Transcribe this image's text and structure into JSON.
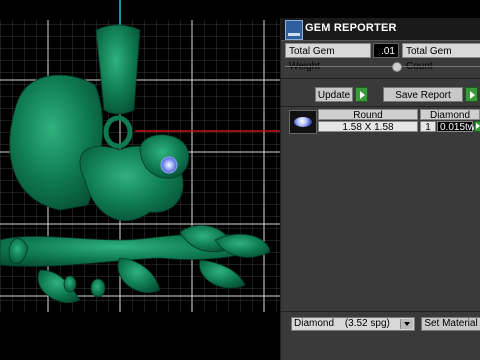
{
  "panel": {
    "title": "GEM REPORTER",
    "total_weight_label": "Total Gem Weight",
    "total_weight_value": ".01",
    "total_count_label": "Total Gem Count",
    "update_label": "Update",
    "save_report_label": "Save Report",
    "gem_row": {
      "shape_header": "Round",
      "material_header": "Diamond",
      "size": "1.58 X 1.58",
      "count": "1",
      "weight": "0.015tw"
    },
    "material_select": "Diamond",
    "material_sg": "(3.52 spg)",
    "set_material_label": "Set Material"
  },
  "colors": {
    "grid": "#cfcfcf",
    "model": "#0f7a52",
    "axis_red": "#d01010",
    "axis_cyan": "#19c7d6",
    "panel_bg": "#3a3a3a",
    "accent_green": "#3a9a3a"
  },
  "icons": {
    "app": "gem-reporter-app-icon",
    "play": "green-play-icon",
    "gem_thumb": "round-diamond-icon"
  }
}
